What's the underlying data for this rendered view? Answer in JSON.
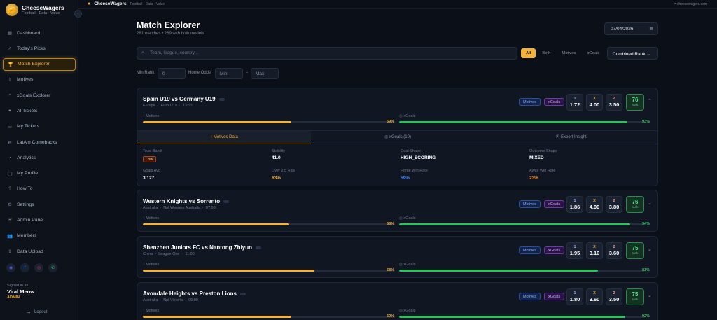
{
  "brand": {
    "name": "CheeseWagers",
    "tagline": "Football · Data · Value",
    "logo_glyph": "🧀"
  },
  "topbar": {
    "brand": "CheeseWagers",
    "crumb": "Football · Data · Value",
    "site": "cheesewagers.com"
  },
  "sidebar": {
    "items": [
      {
        "label": "Dashboard",
        "icon": "▦"
      },
      {
        "label": "Today's Picks",
        "icon": "↗"
      },
      {
        "label": "Match Explorer",
        "icon": "🏆",
        "active": true
      },
      {
        "label": "Motives",
        "icon": "⌇"
      },
      {
        "label": "xGoals Explorer",
        "icon": "⌕"
      },
      {
        "label": "AI Tickets",
        "icon": "✦"
      },
      {
        "label": "My Tickets",
        "icon": "▭"
      },
      {
        "label": "LatAm Comebacks",
        "icon": "⇄"
      },
      {
        "label": "Analytics",
        "icon": "◔"
      },
      {
        "label": "My Profile",
        "icon": "◯"
      },
      {
        "label": "How To",
        "icon": "?"
      },
      {
        "label": "Settings",
        "icon": "⚙"
      },
      {
        "label": "Admin Panel",
        "icon": "⛨"
      },
      {
        "label": "Members",
        "icon": "👥"
      },
      {
        "label": "Data Upload",
        "icon": "⇪"
      }
    ],
    "socials": [
      {
        "icon": "discord-icon",
        "glyph": "◉",
        "color": "#5865f2"
      },
      {
        "icon": "facebook-icon",
        "glyph": "f",
        "color": "#1877f2"
      },
      {
        "icon": "instagram-icon",
        "glyph": "◎",
        "color": "#e1306c"
      },
      {
        "icon": "whatsapp-icon",
        "glyph": "✆",
        "color": "#25d366"
      }
    ],
    "signed_label": "Signed in as",
    "user": "Viral Meow",
    "role": "ADMIN",
    "logout": "Logout"
  },
  "header": {
    "title": "Match Explorer",
    "subtitle": "281 matches • 269 with both models",
    "date": "07/04/2026"
  },
  "search": {
    "placeholder": "Team, league, country..."
  },
  "filters": [
    "All",
    "Both",
    "Motives",
    "xGoals"
  ],
  "rank_select": "Combined Rank",
  "min_rank": {
    "label": "Min Rank",
    "value": "0"
  },
  "home_odds": {
    "label": "Home Odds",
    "min": "Min",
    "sep": "-",
    "max": "Max"
  },
  "tag_motives": "Motives",
  "tag_xgoals": "xGoals",
  "odds_keys": {
    "home": "1",
    "draw": "X",
    "away": "2"
  },
  "rank_label": "rank",
  "bar_label_motives": "Motives",
  "bar_label_xgoals": "xGoals",
  "matches": [
    {
      "title": "Spain U19 vs Germany U19",
      "country": "Europe",
      "league": "Euro U19",
      "time": "13:00",
      "o1": "1.72",
      "ox": "4.00",
      "o2": "3.50",
      "rank": "76",
      "motives": 59,
      "motives_label": "59%",
      "xgoals": 93,
      "xgoals_label": "93%"
    },
    {
      "title": "Western Knights vs Sorrento",
      "country": "Australia",
      "league": "Npl Western Australia",
      "time": "07:00",
      "o1": "1.86",
      "ox": "4.00",
      "o2": "3.80",
      "rank": "76",
      "motives": 58,
      "motives_label": "58%",
      "xgoals": 94,
      "xgoals_label": "94%"
    },
    {
      "title": "Shenzhen Juniors FC vs Nantong Zhiyun",
      "country": "China",
      "league": "League One",
      "time": "11:00",
      "o1": "1.95",
      "ox": "3.10",
      "o2": "3.60",
      "rank": "75",
      "motives": 68,
      "motives_label": "68%",
      "xgoals": 81,
      "xgoals_label": "81%"
    },
    {
      "title": "Avondale Heights vs Preston Lions",
      "country": "Australia",
      "league": "Npl Victoria",
      "time": "05:00",
      "o1": "1.80",
      "ox": "3.60",
      "o2": "3.50",
      "rank": "75",
      "motives": 59,
      "motives_label": "59%",
      "xgoals": 92,
      "xgoals_label": "92%"
    }
  ],
  "detail_tabs": [
    "Motives Data",
    "xGoals (10)",
    "Export Insight"
  ],
  "detail": {
    "trust_band": {
      "label": "Trust Band",
      "value": "LOW"
    },
    "stability": {
      "label": "Stability",
      "value": "41.0"
    },
    "goal_shape": {
      "label": "Goal Shape",
      "value": "HIGH_SCORING"
    },
    "outcome_shape": {
      "label": "Outcome Shape",
      "value": "MIXED"
    },
    "goals_avg": {
      "label": "Goals Avg",
      "value": "3.127"
    },
    "over25": {
      "label": "Over 2.5 Rate",
      "value": "63%"
    },
    "home_win": {
      "label": "Home Win Rate",
      "value": "59%"
    },
    "away_win": {
      "label": "Away Win Rate",
      "value": "23%"
    }
  },
  "colors": {
    "accent": "#f3b23a",
    "green": "#2fc15e",
    "blue": "#3d8bff",
    "orange": "#ff9a3a"
  }
}
